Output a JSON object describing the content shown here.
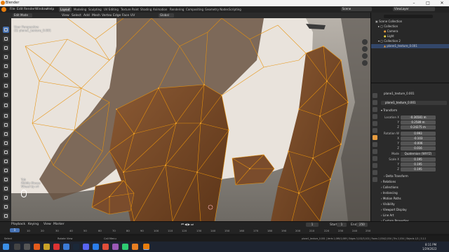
{
  "window": {
    "title": "Blender",
    "minimize": "–",
    "maximize": "□",
    "close": "✕"
  },
  "menu": [
    "File",
    "Edit",
    "Render",
    "Window",
    "Help"
  ],
  "workspace_tabs": [
    "Layout",
    "Modeling",
    "Sculpting",
    "UV Editing",
    "Texture Paint",
    "Shading",
    "Animation",
    "Rendering",
    "Compositing",
    "Geometry Nodes",
    "Scripting"
  ],
  "active_workspace": "Layout",
  "scene": {
    "label": "Scene",
    "view_layer": "ViewLayer"
  },
  "header": {
    "mode": "Edit Mode",
    "menus": [
      "View",
      "Select",
      "Add",
      "Mesh",
      "Vertex",
      "Edge",
      "Face",
      "UV"
    ],
    "orientation": "Global",
    "options": "Options"
  },
  "viewport": {
    "perspective": "User Perspective",
    "object_label": "(1) plane1_texture_0.001",
    "mouse_hint": [
      "Tab",
      "Middle Mouse",
      "Wheel Up x4"
    ],
    "mesh_color": "#e8920c"
  },
  "outliner": {
    "title": "Scene Collection",
    "items": [
      {
        "label": "Scene Collection"
      },
      {
        "label": "Collection"
      },
      {
        "label": "Camera"
      },
      {
        "label": "Light"
      },
      {
        "label": "Collection 2"
      },
      {
        "label": "plane1_texture_0.001"
      }
    ]
  },
  "properties": {
    "object_name": "plane1_texture_0.001",
    "data_name": "plane1_texture_0.001",
    "transform_label": "Transform",
    "location_label": "Location X",
    "location": [
      "-0.36581 m",
      "0.2589 m",
      "0.24275 m"
    ],
    "rotation_label": "Rotation W",
    "rotation": [
      "0.993",
      "-0.103",
      "-0.006",
      "0.016"
    ],
    "mode_label": "Mode",
    "mode_value": "Quaternion (WXYZ)",
    "scale_label": "Scale X",
    "scale": [
      "0.195",
      "0.195",
      "0.195"
    ],
    "axis_labels": [
      "X",
      "Y",
      "Z",
      "W"
    ],
    "sections": [
      "Delta Transform",
      "Relations",
      "Collections",
      "Instancing",
      "Motion Paths",
      "Visibility",
      "Viewport Display",
      "Line Art",
      "Custom Properties"
    ]
  },
  "timeline": {
    "menus": [
      "Playback",
      "Keying",
      "View",
      "Marker"
    ],
    "current_frame": "1",
    "start_label": "Start",
    "start": "1",
    "end_label": "End",
    "end": "250",
    "ticks": [
      "10",
      "20",
      "30",
      "40",
      "50",
      "60",
      "70",
      "80",
      "90",
      "100",
      "110",
      "120",
      "130",
      "140",
      "150",
      "160",
      "170",
      "180",
      "190",
      "200",
      "210",
      "220",
      "230",
      "240",
      "250"
    ]
  },
  "statusbar": {
    "left": [
      "Select",
      "Rotate View",
      "Call Menu"
    ],
    "right": "plane1_texture_0.001 | Verts 1,069/1,069 | Edges 3,102/3,102 | Faces 2,034/2,034 | Tris 2,034 | Objects 1/2 | 3.2.2"
  },
  "taskbar": {
    "time": "8:11 PM",
    "date": "1/29/2022"
  }
}
